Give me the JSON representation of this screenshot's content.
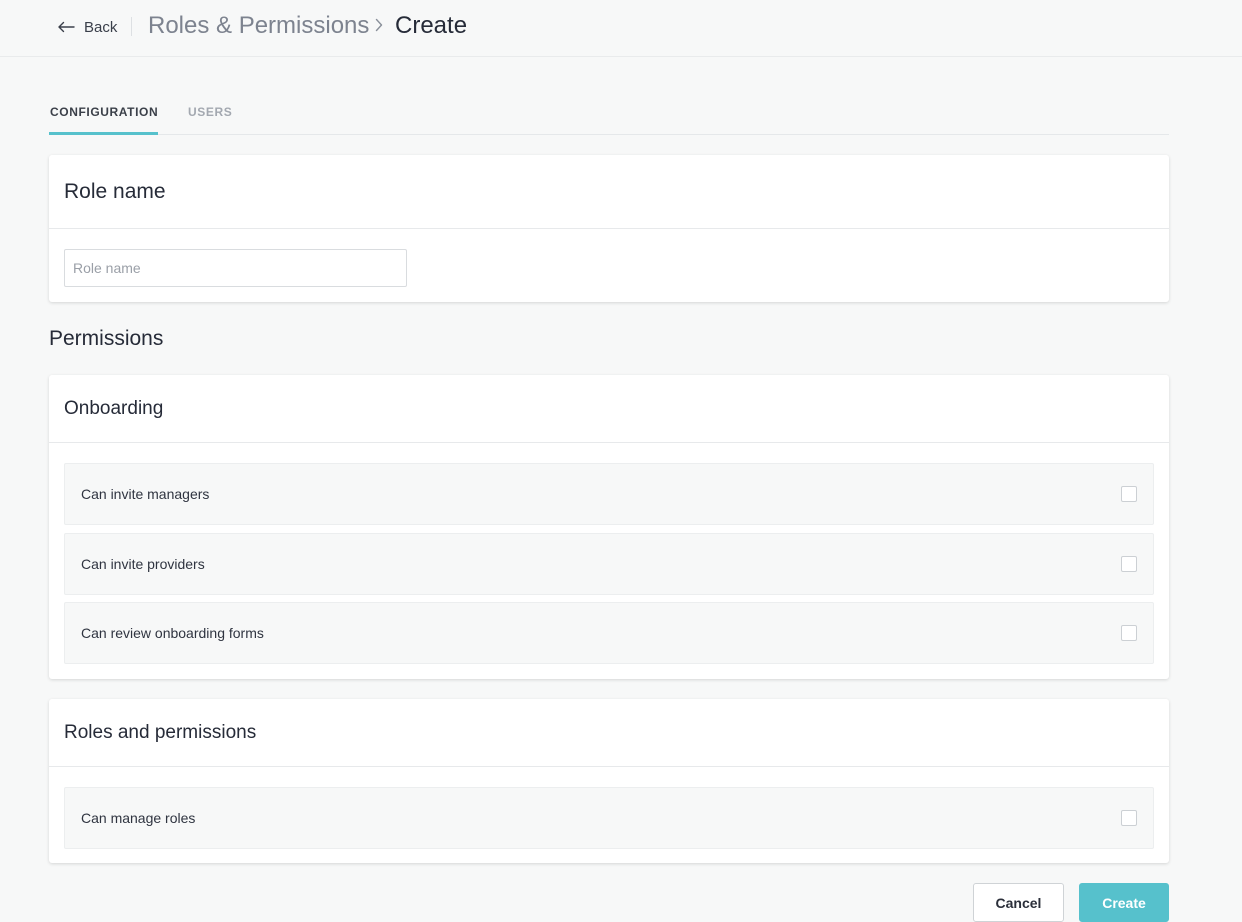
{
  "header": {
    "back_label": "Back",
    "breadcrumb_parent": "Roles & Permissions",
    "breadcrumb_current": "Create"
  },
  "tabs": [
    {
      "label": "CONFIGURATION",
      "active": true
    },
    {
      "label": "USERS",
      "active": false
    }
  ],
  "role_card": {
    "title": "Role name",
    "input_placeholder": "Role name",
    "input_value": ""
  },
  "permissions": {
    "title": "Permissions",
    "groups": [
      {
        "title": "Onboarding",
        "items": [
          {
            "label": "Can invite managers",
            "checked": false
          },
          {
            "label": "Can invite providers",
            "checked": false
          },
          {
            "label": "Can review onboarding forms",
            "checked": false
          }
        ]
      },
      {
        "title": "Roles and permissions",
        "items": [
          {
            "label": "Can manage roles",
            "checked": false
          }
        ]
      }
    ]
  },
  "actions": {
    "cancel_label": "Cancel",
    "create_label": "Create"
  },
  "colors": {
    "accent": "#56c1cc",
    "background": "#f7f8f8",
    "text": "#262b38"
  }
}
